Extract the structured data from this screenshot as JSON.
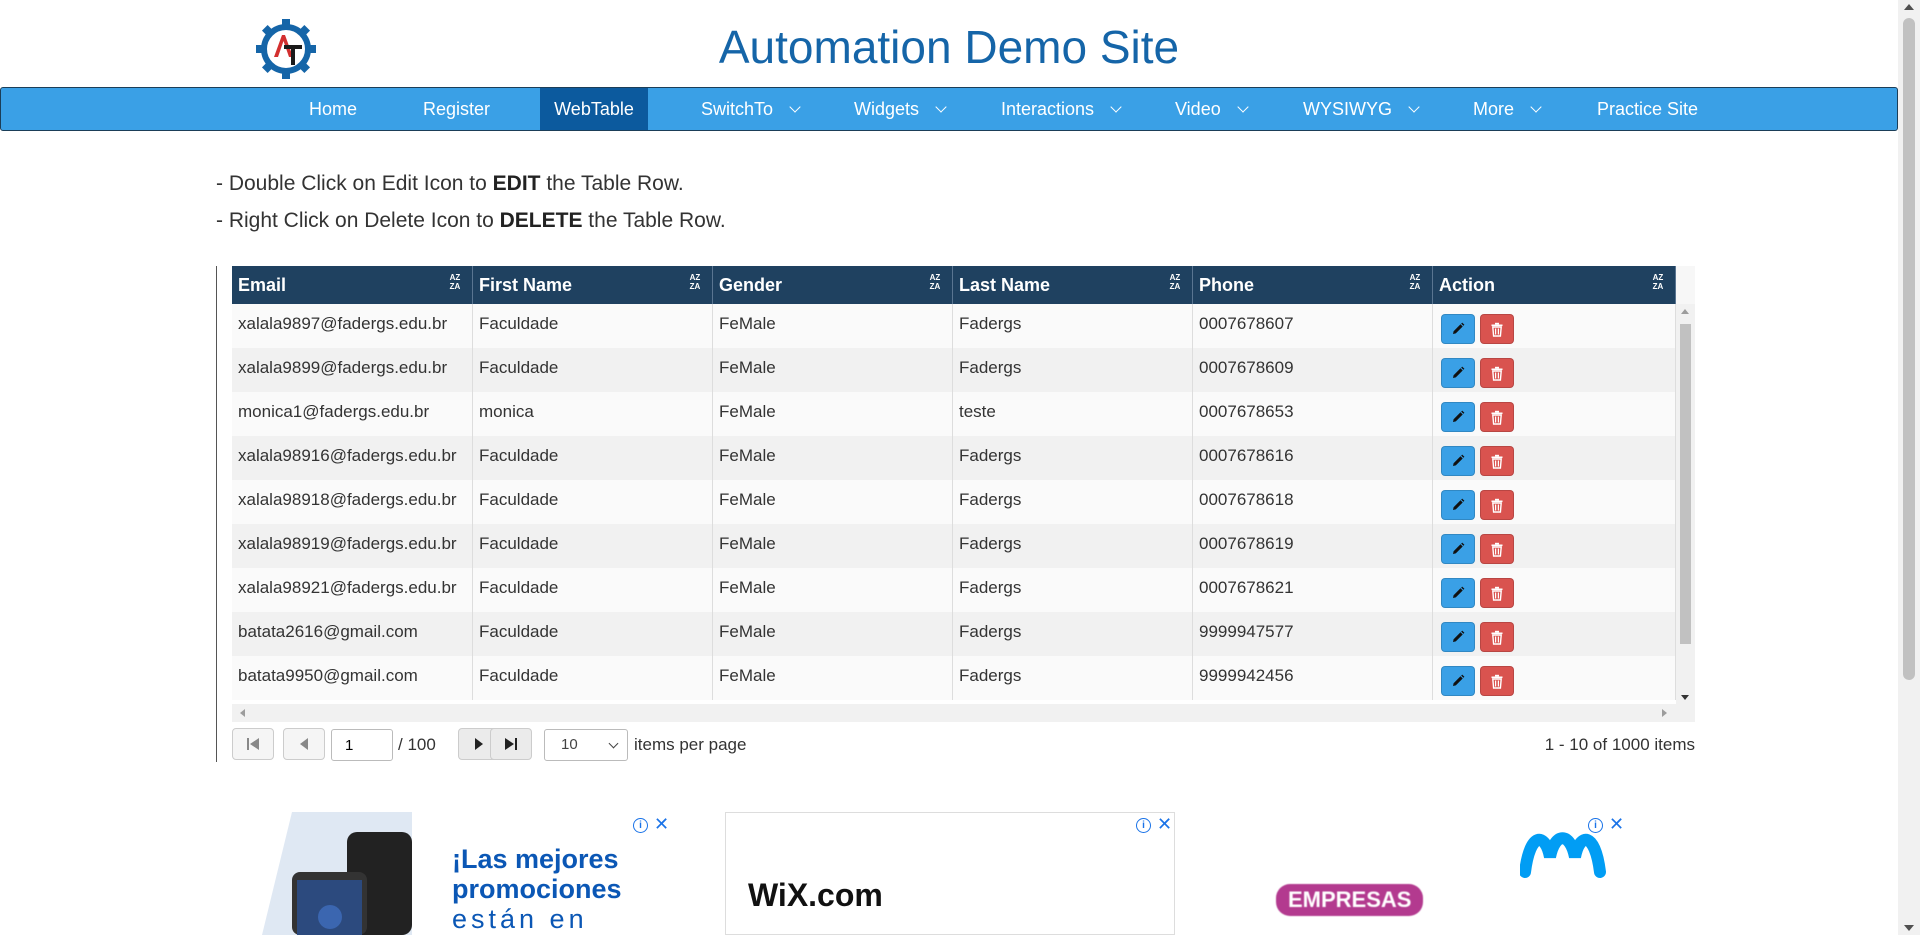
{
  "site": {
    "title": "Automation Demo Site"
  },
  "nav": {
    "items": [
      {
        "label": "Home",
        "has_dropdown": false,
        "active": false
      },
      {
        "label": "Register",
        "has_dropdown": false,
        "active": false
      },
      {
        "label": "WebTable",
        "has_dropdown": false,
        "active": true
      },
      {
        "label": "SwitchTo",
        "has_dropdown": true,
        "active": false
      },
      {
        "label": "Widgets",
        "has_dropdown": true,
        "active": false
      },
      {
        "label": "Interactions",
        "has_dropdown": true,
        "active": false
      },
      {
        "label": "Video",
        "has_dropdown": true,
        "active": false
      },
      {
        "label": "WYSIWYG",
        "has_dropdown": true,
        "active": false
      },
      {
        "label": "More",
        "has_dropdown": true,
        "active": false
      },
      {
        "label": "Practice Site",
        "has_dropdown": false,
        "active": false
      }
    ],
    "bg_color": "#3aa0e6",
    "active_color": "#0c5a9e"
  },
  "instructions": [
    {
      "prefix": "- Double Click on Edit Icon to ",
      "bold": "EDIT",
      "suffix": " the Table Row."
    },
    {
      "prefix": "- Right Click on Delete Icon to ",
      "bold": "DELETE",
      "suffix": " the Table Row."
    }
  ],
  "table": {
    "columns": [
      "Email",
      "First Name",
      "Gender",
      "Last Name",
      "Phone",
      "Action"
    ],
    "header_color": "#1f4160",
    "rows": [
      [
        "xalala9897@fadergs.edu.br",
        "Faculdade",
        "FeMale",
        "Fadergs",
        "0007678607"
      ],
      [
        "xalala9899@fadergs.edu.br",
        "Faculdade",
        "FeMale",
        "Fadergs",
        "0007678609"
      ],
      [
        "monica1@fadergs.edu.br",
        "monica",
        "FeMale",
        "teste",
        "0007678653"
      ],
      [
        "xalala98916@fadergs.edu.br",
        "Faculdade",
        "FeMale",
        "Fadergs",
        "0007678616"
      ],
      [
        "xalala98918@fadergs.edu.br",
        "Faculdade",
        "FeMale",
        "Fadergs",
        "0007678618"
      ],
      [
        "xalala98919@fadergs.edu.br",
        "Faculdade",
        "FeMale",
        "Fadergs",
        "0007678619"
      ],
      [
        "xalala98921@fadergs.edu.br",
        "Faculdade",
        "FeMale",
        "Fadergs",
        "0007678621"
      ],
      [
        "batata2616@gmail.com",
        "Faculdade",
        "FeMale",
        "Fadergs",
        "9999947577"
      ],
      [
        "batata9950@gmail.com",
        "Faculdade",
        "FeMale",
        "Fadergs",
        "9999942456"
      ]
    ],
    "sort_icon": "az-sort-icon",
    "edit_icon": "pencil-icon",
    "delete_icon": "trash-icon",
    "edit_color": "#3aa0e6",
    "delete_color": "#d9534f"
  },
  "pager": {
    "current_page": "1",
    "total_pages": "/ 100",
    "page_size": "10",
    "page_size_label": "items per page",
    "info": "1 - 10 of 1000 items"
  },
  "ads": [
    {
      "text_lines": [
        "¡Las mejores",
        "promociones",
        "están en"
      ],
      "brand": ""
    },
    {
      "text_lines": [],
      "brand": "WiX.com"
    },
    {
      "text_lines": [],
      "brand": "EMPRESAS"
    }
  ]
}
